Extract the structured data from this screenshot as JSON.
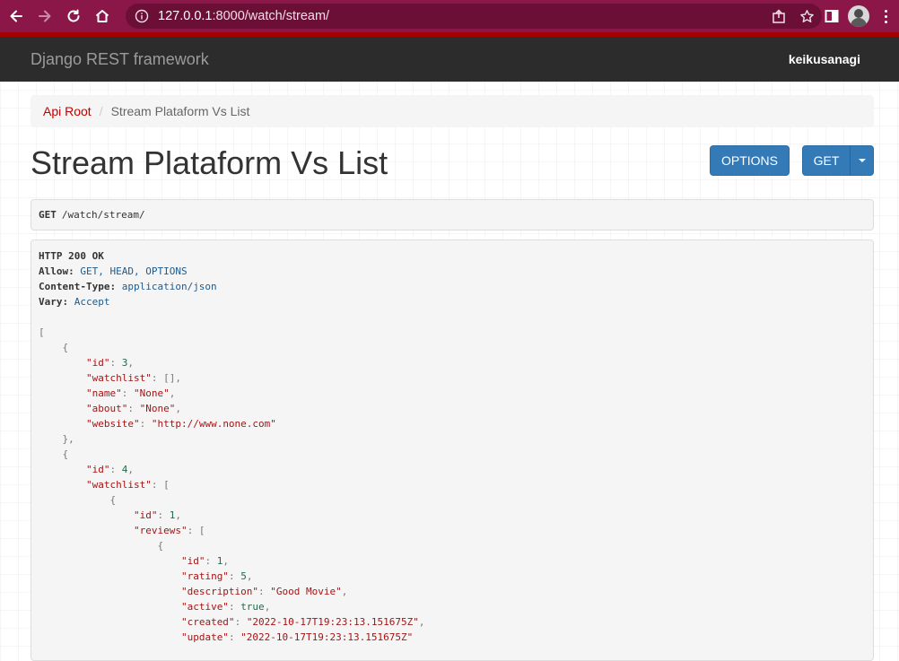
{
  "browser": {
    "url_host": "127.0.0.1",
    "url_rest": ":8000/watch/stream/"
  },
  "navbar": {
    "brand": "Django REST framework",
    "user": "keikusanagi"
  },
  "breadcrumb": {
    "root": "Api Root",
    "separator": "/",
    "current": "Stream Plataform Vs List"
  },
  "page": {
    "title": "Stream Plataform Vs List",
    "options_label": "OPTIONS",
    "get_label": "GET"
  },
  "request": {
    "method": "GET",
    "path": "/watch/stream/"
  },
  "response": {
    "status": "HTTP 200 OK",
    "headers": [
      {
        "key": "Allow:",
        "value": "GET, HEAD, OPTIONS"
      },
      {
        "key": "Content-Type:",
        "value": "application/json"
      },
      {
        "key": "Vary:",
        "value": "Accept"
      }
    ],
    "body_lines": [
      [
        {
          "t": "p",
          "v": "["
        }
      ],
      [
        {
          "t": "p",
          "v": "    {"
        }
      ],
      [
        {
          "t": "x",
          "v": "        "
        },
        {
          "t": "k",
          "v": "\"id\""
        },
        {
          "t": "p",
          "v": ": "
        },
        {
          "t": "n",
          "v": "3"
        },
        {
          "t": "p",
          "v": ","
        }
      ],
      [
        {
          "t": "x",
          "v": "        "
        },
        {
          "t": "k",
          "v": "\"watchlist\""
        },
        {
          "t": "p",
          "v": ": [],"
        }
      ],
      [
        {
          "t": "x",
          "v": "        "
        },
        {
          "t": "k",
          "v": "\"name\""
        },
        {
          "t": "p",
          "v": ": "
        },
        {
          "t": "s",
          "v": "\"None\""
        },
        {
          "t": "p",
          "v": ","
        }
      ],
      [
        {
          "t": "x",
          "v": "        "
        },
        {
          "t": "k",
          "v": "\"about\""
        },
        {
          "t": "p",
          "v": ": "
        },
        {
          "t": "s",
          "v": "\"None\""
        },
        {
          "t": "p",
          "v": ","
        }
      ],
      [
        {
          "t": "x",
          "v": "        "
        },
        {
          "t": "k",
          "v": "\"website\""
        },
        {
          "t": "p",
          "v": ": "
        },
        {
          "t": "s",
          "v": "\"http://www.none.com\""
        }
      ],
      [
        {
          "t": "p",
          "v": "    },"
        }
      ],
      [
        {
          "t": "p",
          "v": "    {"
        }
      ],
      [
        {
          "t": "x",
          "v": "        "
        },
        {
          "t": "k",
          "v": "\"id\""
        },
        {
          "t": "p",
          "v": ": "
        },
        {
          "t": "n",
          "v": "4"
        },
        {
          "t": "p",
          "v": ","
        }
      ],
      [
        {
          "t": "x",
          "v": "        "
        },
        {
          "t": "k",
          "v": "\"watchlist\""
        },
        {
          "t": "p",
          "v": ": ["
        }
      ],
      [
        {
          "t": "p",
          "v": "            {"
        }
      ],
      [
        {
          "t": "x",
          "v": "                "
        },
        {
          "t": "k",
          "v": "\"id\""
        },
        {
          "t": "p",
          "v": ": "
        },
        {
          "t": "n",
          "v": "1"
        },
        {
          "t": "p",
          "v": ","
        }
      ],
      [
        {
          "t": "x",
          "v": "                "
        },
        {
          "t": "k",
          "v": "\"reviews\""
        },
        {
          "t": "p",
          "v": ": ["
        }
      ],
      [
        {
          "t": "p",
          "v": "                    {"
        }
      ],
      [
        {
          "t": "x",
          "v": "                        "
        },
        {
          "t": "k",
          "v": "\"id\""
        },
        {
          "t": "p",
          "v": ": "
        },
        {
          "t": "n",
          "v": "1"
        },
        {
          "t": "p",
          "v": ","
        }
      ],
      [
        {
          "t": "x",
          "v": "                        "
        },
        {
          "t": "k",
          "v": "\"rating\""
        },
        {
          "t": "p",
          "v": ": "
        },
        {
          "t": "n",
          "v": "5"
        },
        {
          "t": "p",
          "v": ","
        }
      ],
      [
        {
          "t": "x",
          "v": "                        "
        },
        {
          "t": "k",
          "v": "\"description\""
        },
        {
          "t": "p",
          "v": ": "
        },
        {
          "t": "s",
          "v": "\"Good Movie\""
        },
        {
          "t": "p",
          "v": ","
        }
      ],
      [
        {
          "t": "x",
          "v": "                        "
        },
        {
          "t": "k",
          "v": "\"active\""
        },
        {
          "t": "p",
          "v": ": "
        },
        {
          "t": "n",
          "v": "true"
        },
        {
          "t": "p",
          "v": ","
        }
      ],
      [
        {
          "t": "x",
          "v": "                        "
        },
        {
          "t": "k",
          "v": "\"created\""
        },
        {
          "t": "p",
          "v": ": "
        },
        {
          "t": "s",
          "v": "\"2022-10-17T19:23:13.151675Z\""
        },
        {
          "t": "p",
          "v": ","
        }
      ],
      [
        {
          "t": "x",
          "v": "                        "
        },
        {
          "t": "k",
          "v": "\"update\""
        },
        {
          "t": "p",
          "v": ": "
        },
        {
          "t": "s",
          "v": "\"2022-10-17T19:23:13.151675Z\""
        }
      ]
    ]
  },
  "colors": {
    "browser_frame": "#8a1747",
    "navbar_bg": "#2c2c2c",
    "navbar_accent": "#a30000",
    "link": "#c20000",
    "button": "#337ab7"
  }
}
